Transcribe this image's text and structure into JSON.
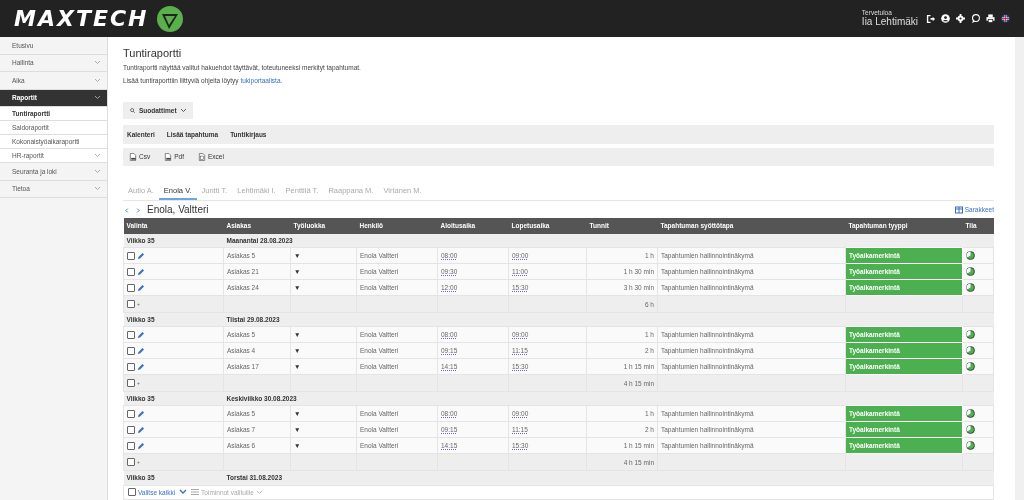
{
  "header": {
    "logo": "MAXTECH",
    "welcome": "Tervetuloa",
    "user": "Iia Lehtimäki"
  },
  "sidebar": {
    "items": [
      {
        "label": "Etusivu",
        "has_submenu": false,
        "selected": false
      },
      {
        "label": "Hallinta",
        "has_submenu": true,
        "selected": false
      },
      {
        "label": "Aika",
        "has_submenu": true,
        "selected": false
      },
      {
        "label": "Raportit",
        "has_submenu": true,
        "selected": true,
        "children": [
          {
            "label": "Tuntiraportti",
            "has_submenu": false,
            "selected": true
          },
          {
            "label": "Saldoraportit",
            "has_submenu": false,
            "selected": false
          },
          {
            "label": "Kokonaistyöaikaraportti",
            "has_submenu": false,
            "selected": false
          },
          {
            "label": "HR-raportit",
            "has_submenu": true,
            "selected": false
          }
        ]
      },
      {
        "label": "Seuranta ja loki",
        "has_submenu": true,
        "selected": false
      },
      {
        "label": "Tietoa",
        "has_submenu": true,
        "selected": false
      }
    ]
  },
  "page": {
    "title": "Tuntiraportti",
    "description": "Tuntiraportti näyttää valitut hakuehdot täyttävät, toteutuneeksi merkityt tapahtumat.",
    "help_text": "Lisää tuntiraporttiin liittyviä ohjeita löytyy ",
    "help_link": "tukiportaalista",
    "help_end": "."
  },
  "filters_button": "Suodattimet",
  "actions": [
    "Kalenteri",
    "Lisää tapahtuma",
    "Tuntikirjaus"
  ],
  "exports": [
    {
      "label": "Csv",
      "kind": "file"
    },
    {
      "label": "Pdf",
      "kind": "file"
    },
    {
      "label": "Excel",
      "kind": "sheet"
    }
  ],
  "tabs": [
    {
      "label": "Autio A.",
      "selected": false
    },
    {
      "label": "Enola V.",
      "selected": true
    },
    {
      "label": "Juntti T.",
      "selected": false
    },
    {
      "label": "Lehtimäki I.",
      "selected": false
    },
    {
      "label": "Penttilä T.",
      "selected": false
    },
    {
      "label": "Raappana M.",
      "selected": false
    },
    {
      "label": "Virtanen M.",
      "selected": false
    }
  ],
  "person_name": "Enola, Valtteri",
  "columns_button": "Sarakkeet",
  "table": {
    "columns": [
      "Valinta",
      "Asiakas",
      "Työluokka",
      "Henkilö",
      "Aloitusaika",
      "Lopetusaika",
      "Tunnit",
      "Tapahtuman syöttötapa",
      "Tapahtuman tyyppi",
      "Tila"
    ],
    "groups": [
      {
        "week": "Viikko 35",
        "day": "Maanantai 28.08.2023",
        "rows": [
          {
            "checked": false,
            "customer": "Asiakas 5",
            "class": "▼",
            "person": "Enola Valtteri",
            "start": "08:00",
            "end": "09:00",
            "hours": "1 h",
            "method": "Tapahtumien hallinnointinäkymä",
            "type": "Työaikamerkintä"
          },
          {
            "checked": false,
            "customer": "Asiakas 21",
            "class": "▼",
            "person": "Enola Valtteri",
            "start": "09:30",
            "end": "11:00",
            "hours": "1 h 30 min",
            "method": "Tapahtumien hallinnointinäkymä",
            "type": "Työaikamerkintä"
          },
          {
            "checked": false,
            "customer": "Asiakas 24",
            "class": "▼",
            "person": "Enola Valtteri",
            "start": "12:00",
            "end": "15:30",
            "hours": "3 h 30 min",
            "method": "Tapahtumien hallinnointinäkymä",
            "type": "Työaikamerkintä"
          }
        ],
        "total": {
          "checked": false,
          "add": "+",
          "hours": "6 h"
        }
      },
      {
        "week": "Viikko 35",
        "day": "Tiistai 29.08.2023",
        "rows": [
          {
            "checked": false,
            "customer": "Asiakas 5",
            "class": "▼",
            "person": "Enola Valtteri",
            "start": "08:00",
            "end": "09:00",
            "hours": "1 h",
            "method": "Tapahtumien hallinnointinäkymä",
            "type": "Työaikamerkintä"
          },
          {
            "checked": false,
            "customer": "Asiakas 4",
            "class": "▼",
            "person": "Enola Valtteri",
            "start": "09:15",
            "end": "11:15",
            "hours": "2 h",
            "method": "Tapahtumien hallinnointinäkymä",
            "type": "Työaikamerkintä"
          },
          {
            "checked": false,
            "customer": "Asiakas 17",
            "class": "▼",
            "person": "Enola Valtteri",
            "start": "14:15",
            "end": "15:30",
            "hours": "1 h 15 min",
            "method": "Tapahtumien hallinnointinäkymä",
            "type": "Työaikamerkintä"
          }
        ],
        "total": {
          "checked": false,
          "add": "+",
          "hours": "4 h 15 min"
        }
      },
      {
        "week": "Viikko 35",
        "day": "Keskiviikko 30.08.2023",
        "rows": [
          {
            "checked": false,
            "customer": "Asiakas 5",
            "class": "▼",
            "person": "Enola Valtteri",
            "start": "08:00",
            "end": "09:00",
            "hours": "1 h",
            "method": "Tapahtumien hallinnointinäkymä",
            "type": "Työaikamerkintä"
          },
          {
            "checked": false,
            "customer": "Asiakas 7",
            "class": "▼",
            "person": "Enola Valtteri",
            "start": "09:15",
            "end": "11:15",
            "hours": "2 h",
            "method": "Tapahtumien hallinnointinäkymä",
            "type": "Työaikamerkintä"
          },
          {
            "checked": false,
            "customer": "Asiakas 6",
            "class": "▼",
            "person": "Enola Valtteri",
            "start": "14:15",
            "end": "15:30",
            "hours": "1 h 15 min",
            "method": "Tapahtumien hallinnointinäkymä",
            "type": "Työaikamerkintä"
          }
        ],
        "total": {
          "checked": false,
          "add": "+",
          "hours": "4 h 15 min"
        }
      },
      {
        "week": "Viikko 35",
        "day": "Torstai 31.08.2023"
      }
    ]
  },
  "footer": {
    "select_all": "Valitse kaikki",
    "select_all_checked": false,
    "bulk_actions": "Toiminnot valituille"
  }
}
